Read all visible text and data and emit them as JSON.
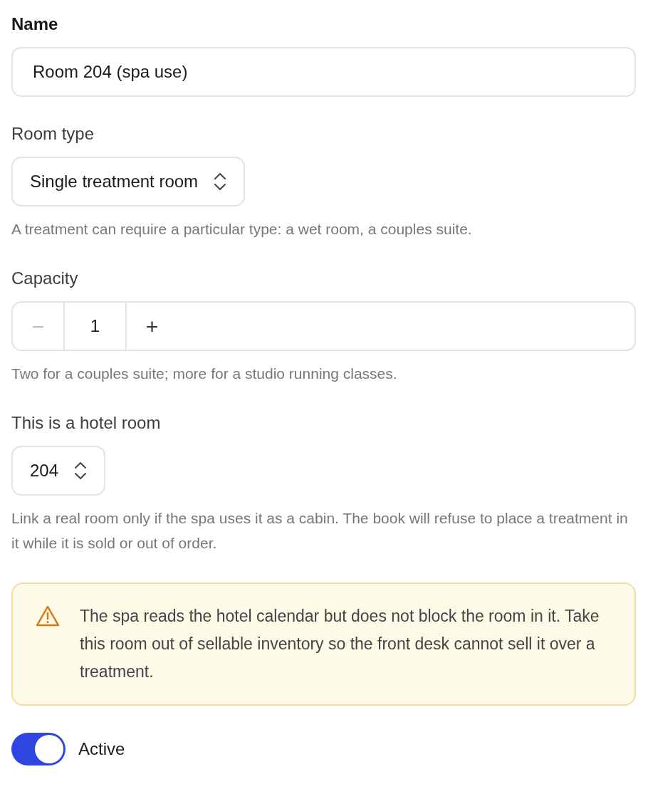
{
  "fields": [
    {
      "kind": "text",
      "label": "Name",
      "value": "Room 204 (spa use)"
    },
    {
      "kind": "select",
      "label": "Room type",
      "value": "Single treatment room",
      "help": "A treatment can require a particular type: a wet room, a couples suite."
    },
    {
      "kind": "stepper",
      "label": "Capacity",
      "value": "1",
      "decrement": "−",
      "increment": "+",
      "decrement_disabled": true,
      "help": "Two for a couples suite; more for a studio running classes."
    },
    {
      "kind": "select",
      "label": "This is a hotel room",
      "value": "204",
      "help": "Link a real room only if the spa uses it as a cabin. The book will refuse to place a treatment in it while it is sold or out of order."
    },
    {
      "kind": "alert",
      "text": "The spa reads the hotel calendar but does not block the room in it. Take this room out of sellable inventory so the front desk cannot sell it over a treatment."
    },
    {
      "kind": "toggle",
      "label": "Active",
      "on": true
    }
  ]
}
